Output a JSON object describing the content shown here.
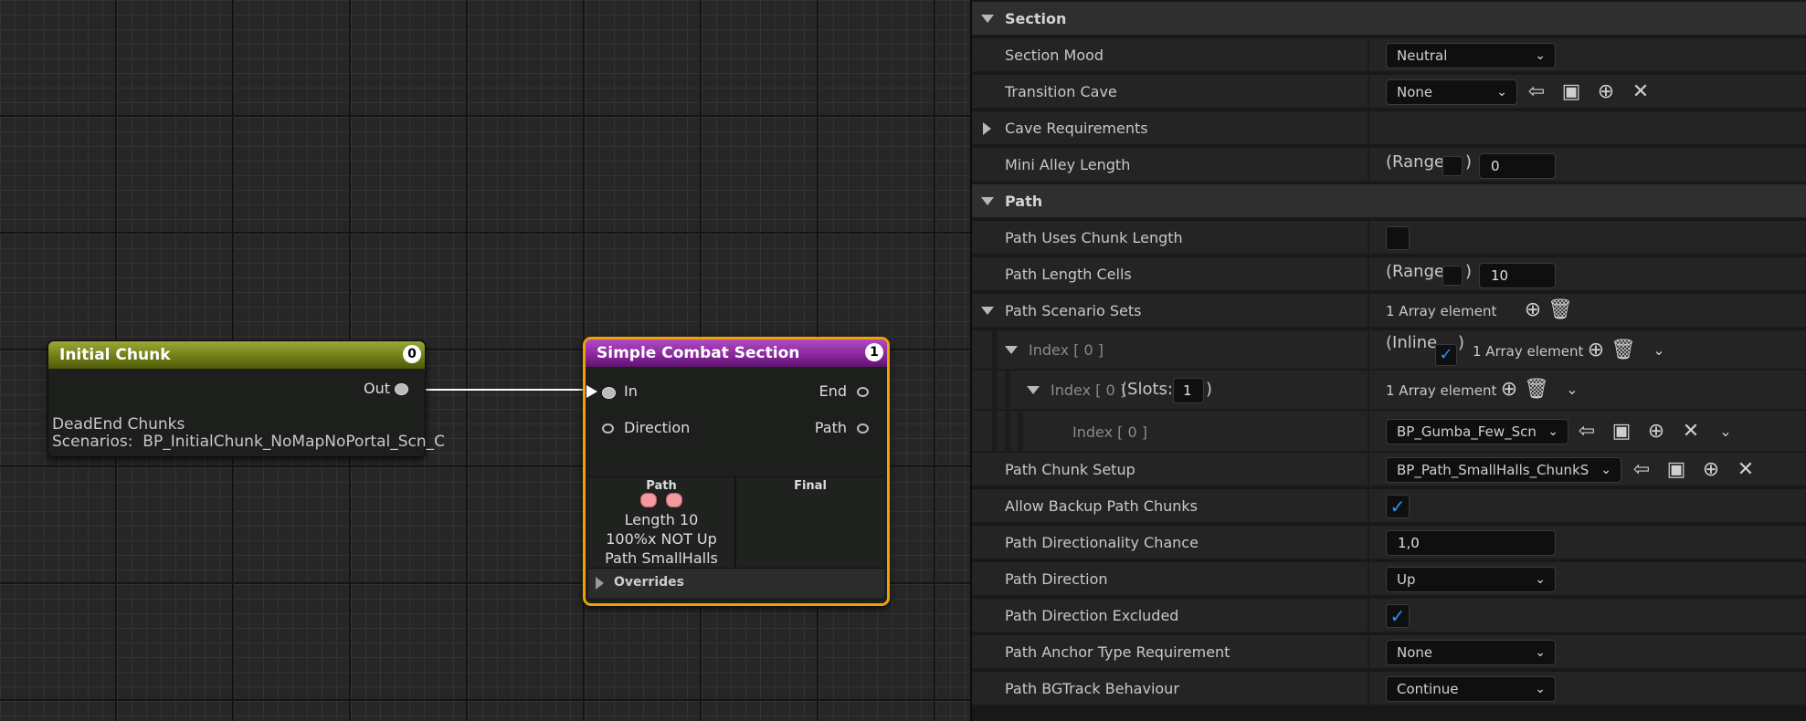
{
  "graph": {
    "node_initial": {
      "title": "Initial Chunk",
      "badge": "0",
      "out_pin": "Out",
      "line1": "DeadEnd Chunks",
      "line2": "Scenarios:  BP_InitialChunk_NoMapNoPortal_Scn_C"
    },
    "node_combat": {
      "title": "Simple Combat Section",
      "badge": "1",
      "pins": {
        "in": "In",
        "direction": "Direction",
        "end": "End",
        "path": "Path"
      },
      "path_column": {
        "title": "Path",
        "length": "Length 10",
        "direction": "100%x NOT Up",
        "name": "Path SmallHalls"
      },
      "final_column": {
        "title": "Final"
      },
      "overrides": "Overrides"
    }
  },
  "panel": {
    "section_header": "Section",
    "section_mood": {
      "label": "Section Mood",
      "value": "Neutral"
    },
    "transition_cave": {
      "label": "Transition Cave",
      "value": "None"
    },
    "cave_requirements": {
      "label": "Cave Requirements"
    },
    "mini_alley_length": {
      "label": "Mini Alley Length",
      "range_label": "(Range",
      "range_close": ")",
      "value": "0"
    },
    "path_header": "Path",
    "path_uses_chunk_length": {
      "label": "Path Uses Chunk Length",
      "checked": false
    },
    "path_length_cells": {
      "label": "Path Length Cells",
      "range_label": "(Range",
      "range_close": ")",
      "value": "10"
    },
    "path_scenario_sets": {
      "label": "Path Scenario Sets",
      "value": "1 Array element"
    },
    "index0": {
      "label": "Index [ 0 ]",
      "inline_label": "(Inline",
      "inline_close": ")",
      "value": "1 Array element"
    },
    "index0_sub": {
      "label": "Index [ 0 ]",
      "slots_label": "(Slots:",
      "slots_value": "1",
      "slots_close": ")",
      "value": "1 Array element"
    },
    "index0_leaf": {
      "label": "Index [ 0 ]",
      "value": "BP_Gumba_Few_Scn"
    },
    "path_chunk_setup": {
      "label": "Path Chunk Setup",
      "value": "BP_Path_SmallHalls_ChunkS"
    },
    "allow_backup": {
      "label": "Allow Backup Path Chunks",
      "checked": true
    },
    "path_dir_chance": {
      "label": "Path Directionality Chance",
      "value": "1,0"
    },
    "path_direction": {
      "label": "Path Direction",
      "value": "Up"
    },
    "path_dir_excluded": {
      "label": "Path Direction Excluded",
      "checked": true
    },
    "path_anchor": {
      "label": "Path Anchor Type Requirement",
      "value": "None"
    },
    "path_bgtrack": {
      "label": "Path BGTrack Behaviour",
      "value": "Continue"
    }
  },
  "icons": {
    "browse": "arrow-left-circle-icon",
    "find": "folder-search-icon",
    "add": "plus-circle-icon",
    "clear": "x-icon",
    "delete": "trash-icon",
    "chevron": "chevron-down-icon"
  },
  "colors": {
    "accent": "#2f8fff",
    "selection": "#f0a000",
    "initial_title": "#7d8a1c",
    "combat_title": "#8e2aa0"
  }
}
